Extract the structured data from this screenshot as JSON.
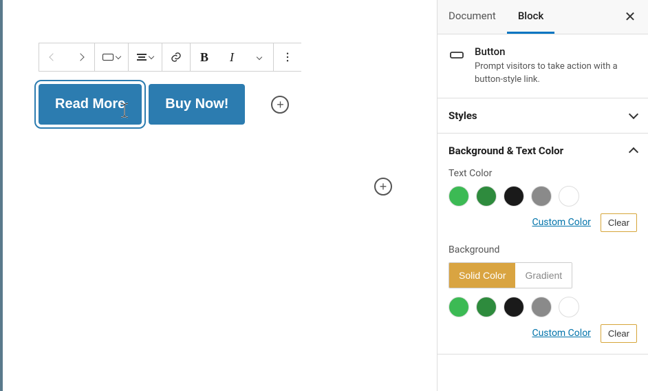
{
  "sidebar": {
    "tabs": {
      "document": "Document",
      "block": "Block"
    },
    "block_card": {
      "title": "Button",
      "description": "Prompt visitors to take action with a button-style link."
    },
    "panels": {
      "styles": "Styles",
      "bg_text": "Background & Text Color"
    },
    "text_color": {
      "label": "Text Color",
      "custom": "Custom Color",
      "clear": "Clear"
    },
    "background": {
      "label": "Background",
      "solid": "Solid Color",
      "gradient": "Gradient",
      "custom": "Custom Color",
      "clear": "Clear"
    },
    "swatches": {
      "green1": "#3cba54",
      "green2": "#2e8b3d",
      "black": "#1a1a1a",
      "gray": "#8a8a8a",
      "white": "#ffffff"
    }
  },
  "editor": {
    "buttons": {
      "read_more": "Read More",
      "buy_now": "Buy Now!"
    },
    "accent": "#2c7cb0"
  },
  "toolbar": {
    "bold": "B",
    "italic": "I"
  }
}
